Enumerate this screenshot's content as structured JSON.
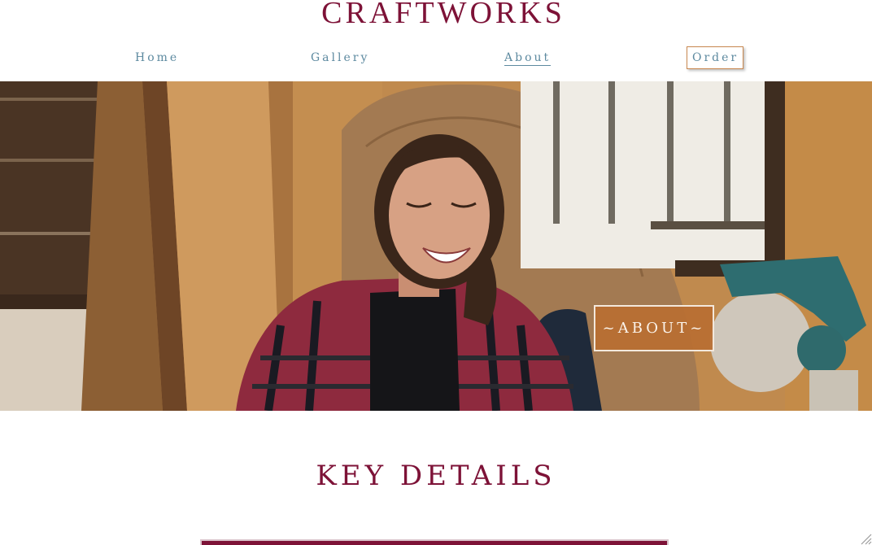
{
  "site": {
    "title": "CRAFTWORKS"
  },
  "nav": {
    "items": [
      {
        "label": "Home"
      },
      {
        "label": "Gallery"
      },
      {
        "label": "About"
      },
      {
        "label": "Order"
      }
    ],
    "active": "About"
  },
  "hero": {
    "badge_label": "~ABOUT~"
  },
  "section": {
    "heading": "KEY DETAILS"
  },
  "colors": {
    "brand": "#7d1237",
    "nav_text": "#5d8aa0",
    "badge_bg": "#b96e32",
    "order_border": "#c8874f"
  },
  "icons": {
    "resize": "resize-grip-icon"
  }
}
